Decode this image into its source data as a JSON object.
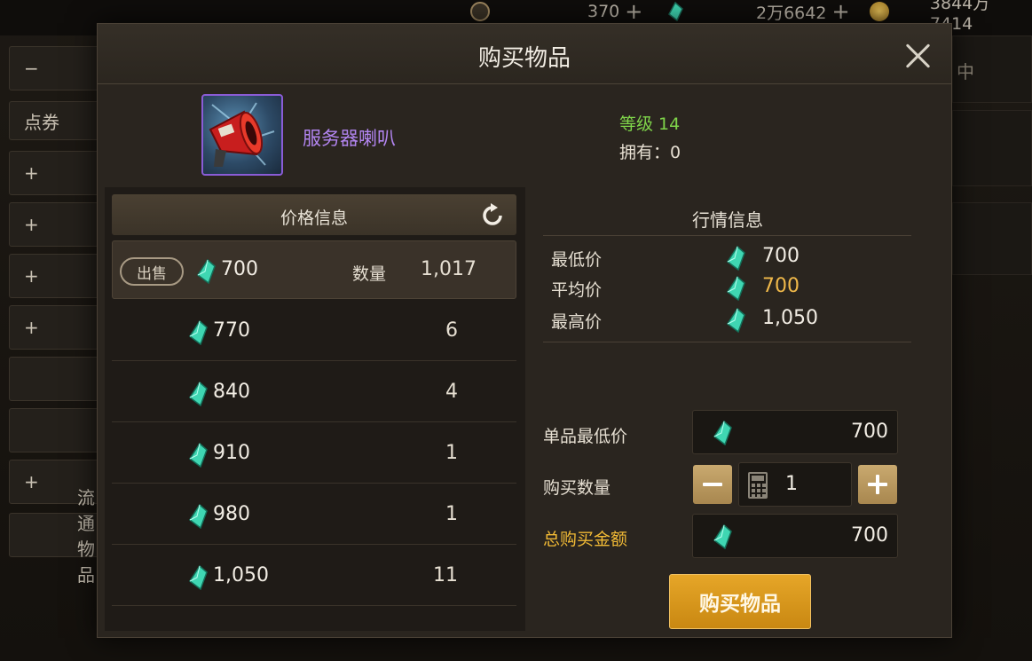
{
  "topbar": {
    "currency1": {
      "icon": "token-icon",
      "value": "370"
    },
    "currency2": {
      "icon": "gem-icon",
      "value": "2万6642"
    },
    "currency3": {
      "icon": "gold-coin-icon",
      "value": "3844万7414"
    }
  },
  "background": {
    "side_buttons": [
      "−",
      "点券",
      "+",
      "+",
      "+",
      "+",
      "",
      "",
      "+",
      "流通物品"
    ],
    "right_tab_text": "中"
  },
  "modal": {
    "title": "购买物品",
    "item": {
      "name": "服务器喇叭",
      "level": "等级 14",
      "owned": "拥有：0"
    },
    "price_panel": {
      "title": "价格信息",
      "sell_tag": "出售",
      "qty_label": "数量",
      "rows": [
        {
          "price": "700",
          "qty": "1,017"
        },
        {
          "price": "770",
          "qty": "6"
        },
        {
          "price": "840",
          "qty": "4"
        },
        {
          "price": "910",
          "qty": "1"
        },
        {
          "price": "980",
          "qty": "1"
        },
        {
          "price": "1,050",
          "qty": "11"
        }
      ]
    },
    "market": {
      "title": "行情信息",
      "min_label": "最低价",
      "min_value": "700",
      "avg_label": "平均价",
      "avg_value": "700",
      "max_label": "最高价",
      "max_value": "1,050"
    },
    "form": {
      "unit_min_label": "单品最低价",
      "unit_min_value": "700",
      "qty_label": "购买数量",
      "qty_value": "1",
      "total_label": "总购买金额",
      "total_value": "700"
    },
    "buy_button": "购买物品"
  },
  "colors": {
    "accent_gold": "#e6a628",
    "item_name_purple": "#b285f0",
    "level_green": "#7fd54a",
    "avg_price_orange": "#f0b94a",
    "total_label_yellow": "#f0b935",
    "gem_teal": "#3fd6b2"
  }
}
